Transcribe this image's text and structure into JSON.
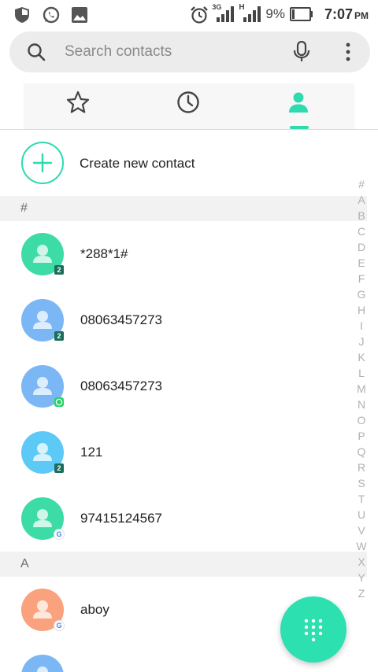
{
  "status_bar": {
    "left_icons": [
      "shield-icon",
      "whatsapp-icon",
      "image-icon"
    ],
    "right_icons": [
      "alarm-icon",
      "signal-3g-icon",
      "signal-h-icon",
      "battery-icon"
    ],
    "network_3g": "3G",
    "network_h": "H",
    "battery_percent": "9%",
    "time": "7:07",
    "ampm": "PM"
  },
  "search": {
    "placeholder": "Search contacts",
    "icon": "search-icon",
    "mic_icon": "microphone-icon",
    "more_icon": "more-vert-icon"
  },
  "tabs": [
    {
      "name": "favorites",
      "icon": "star-icon",
      "selected": false
    },
    {
      "name": "recents",
      "icon": "clock-icon",
      "selected": false
    },
    {
      "name": "contacts",
      "icon": "person-icon",
      "selected": true
    }
  ],
  "accent_color": "#2ddbaf",
  "create_contact": {
    "label": "Create new contact",
    "icon": "plus-icon"
  },
  "sections": [
    {
      "header": "#",
      "contacts": [
        {
          "name": "*288*1#",
          "avatar_color": "#3ddca6",
          "badge": "2",
          "badge_type": "sim"
        },
        {
          "name": "08063457273",
          "avatar_color": "#7bb7f5",
          "badge": "2",
          "badge_type": "sim"
        },
        {
          "name": "08063457273",
          "avatar_color": "#7bb7f5",
          "badge": "",
          "badge_type": "whatsapp"
        },
        {
          "name": "121",
          "avatar_color": "#5cc9f7",
          "badge": "2",
          "badge_type": "sim"
        },
        {
          "name": "97415124567",
          "avatar_color": "#3ddca6",
          "badge": "G",
          "badge_type": "google"
        }
      ]
    },
    {
      "header": "A",
      "contacts": [
        {
          "name": "aboy",
          "avatar_color": "#f9a27d",
          "badge": "G",
          "badge_type": "google"
        }
      ]
    }
  ],
  "partial_contact": {
    "avatar_color": "#7bb7f5"
  },
  "alphabet_index": [
    "#",
    "A",
    "B",
    "C",
    "D",
    "E",
    "F",
    "G",
    "H",
    "I",
    "J",
    "K",
    "L",
    "M",
    "N",
    "O",
    "P",
    "Q",
    "R",
    "S",
    "T",
    "U",
    "V",
    "W",
    "X",
    "Y",
    "Z"
  ],
  "fab": {
    "icon": "dialpad-icon",
    "color": "#2de0b0"
  }
}
